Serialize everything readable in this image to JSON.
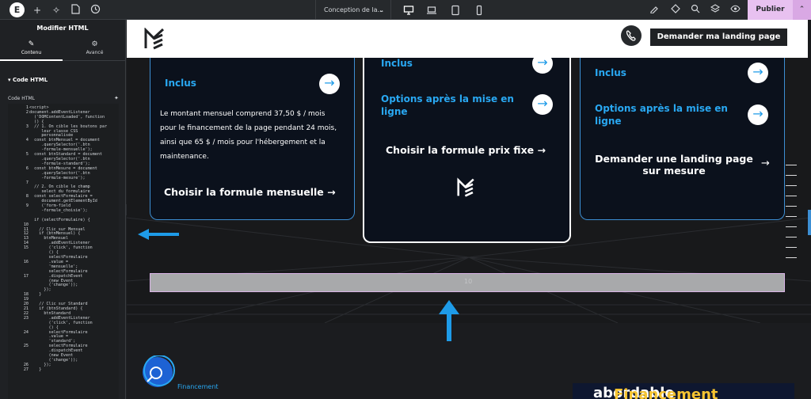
{
  "topbar": {
    "doc_selector": "Conception de la...",
    "publish_label": "Publier"
  },
  "panel": {
    "title": "Modifier HTML",
    "tabs": [
      {
        "label": "Contenu",
        "icon": "pencil-icon"
      },
      {
        "label": "Avancé",
        "icon": "gear-icon"
      }
    ],
    "section_title": "Code HTML",
    "field_label": "Code HTML",
    "line_numbers": "1\n2\n\n\n3\n\n\n4\n\n\n5\n\n\n6\n\n\n7\n\n\n8\n\n9\n\n\n\n10\n11\n12\n13\n14\n15\n\n\n16\n\n\n17\n\n\n\n18\n19\n20\n21\n22\n23\n\n\n24\n\n\n25\n\n\n\n26\n27",
    "code": "<script>\ndocument.addEventListener\n  ('DOMContentLoaded', function\n  () {\n  // 1. On cible les boutons par\n     leur classe CSS\n     personnalisée\n  const btnMensuel = document\n     .querySelector('.btn\n     -formule-mensuelle');\n  const btnStandard = document\n     .querySelector('.btn\n     -formule-standard');\n  const btnMesure = document\n     .querySelector('.btn\n     -formule-mesure');\n\n  // 2. On cible le champ\n     select du formulaire\n  const selectFormulaire =\n     document.getElementById\n     ('form-field\n     -formule_choisie');\n\n  if (selectFormulaire) {\n\n    // Clic sur Mensuel\n    if (btnMensuel) {\n      btnMensuel\n        .addEventListener\n        ('click', function\n        () {\n        selectFormulaire\n        .value =\n        'mensuelle';\n        selectFormulaire\n        .dispatchEvent\n        (new Event\n        ('change'));\n      });\n    }\n\n    // Clic sur Standard\n    if (btnStandard) {\n      btnStandard\n        .addEventListener\n        ('click', function\n        () {\n        selectFormulaire\n        .value =\n        'standard';\n        selectFormulaire\n        .dispatchEvent\n        (new Event\n        ('change'));\n      });\n    }"
  },
  "site": {
    "cta_label": "Demander ma landing page",
    "cards": [
      {
        "rows": [
          "Inclus"
        ],
        "paragraph": "Le montant mensuel comprend 37,50 $ / mois pour le financement de la page pendant 24 mois, ainsi que 65 $ / mois pour l'hébergement et la maintenance.",
        "link": "Choisir la formule mensuelle →"
      },
      {
        "rows": [
          "Inclus",
          "Options après la mise en ligne"
        ],
        "link": "Choisir la formule prix fixe →"
      },
      {
        "rows": [
          "Inclus",
          "Options après la mise en ligne"
        ],
        "link": "Demander une landing page sur mesure"
      }
    ],
    "spacer_handle": "10",
    "financing_label": "Financement",
    "financing_heading_colored": "Financement",
    "financing_heading_rest": "abordable"
  },
  "colors": {
    "accent": "#29a8f2",
    "annotation": "#1e9be8",
    "publish": "#e8c1f0"
  }
}
